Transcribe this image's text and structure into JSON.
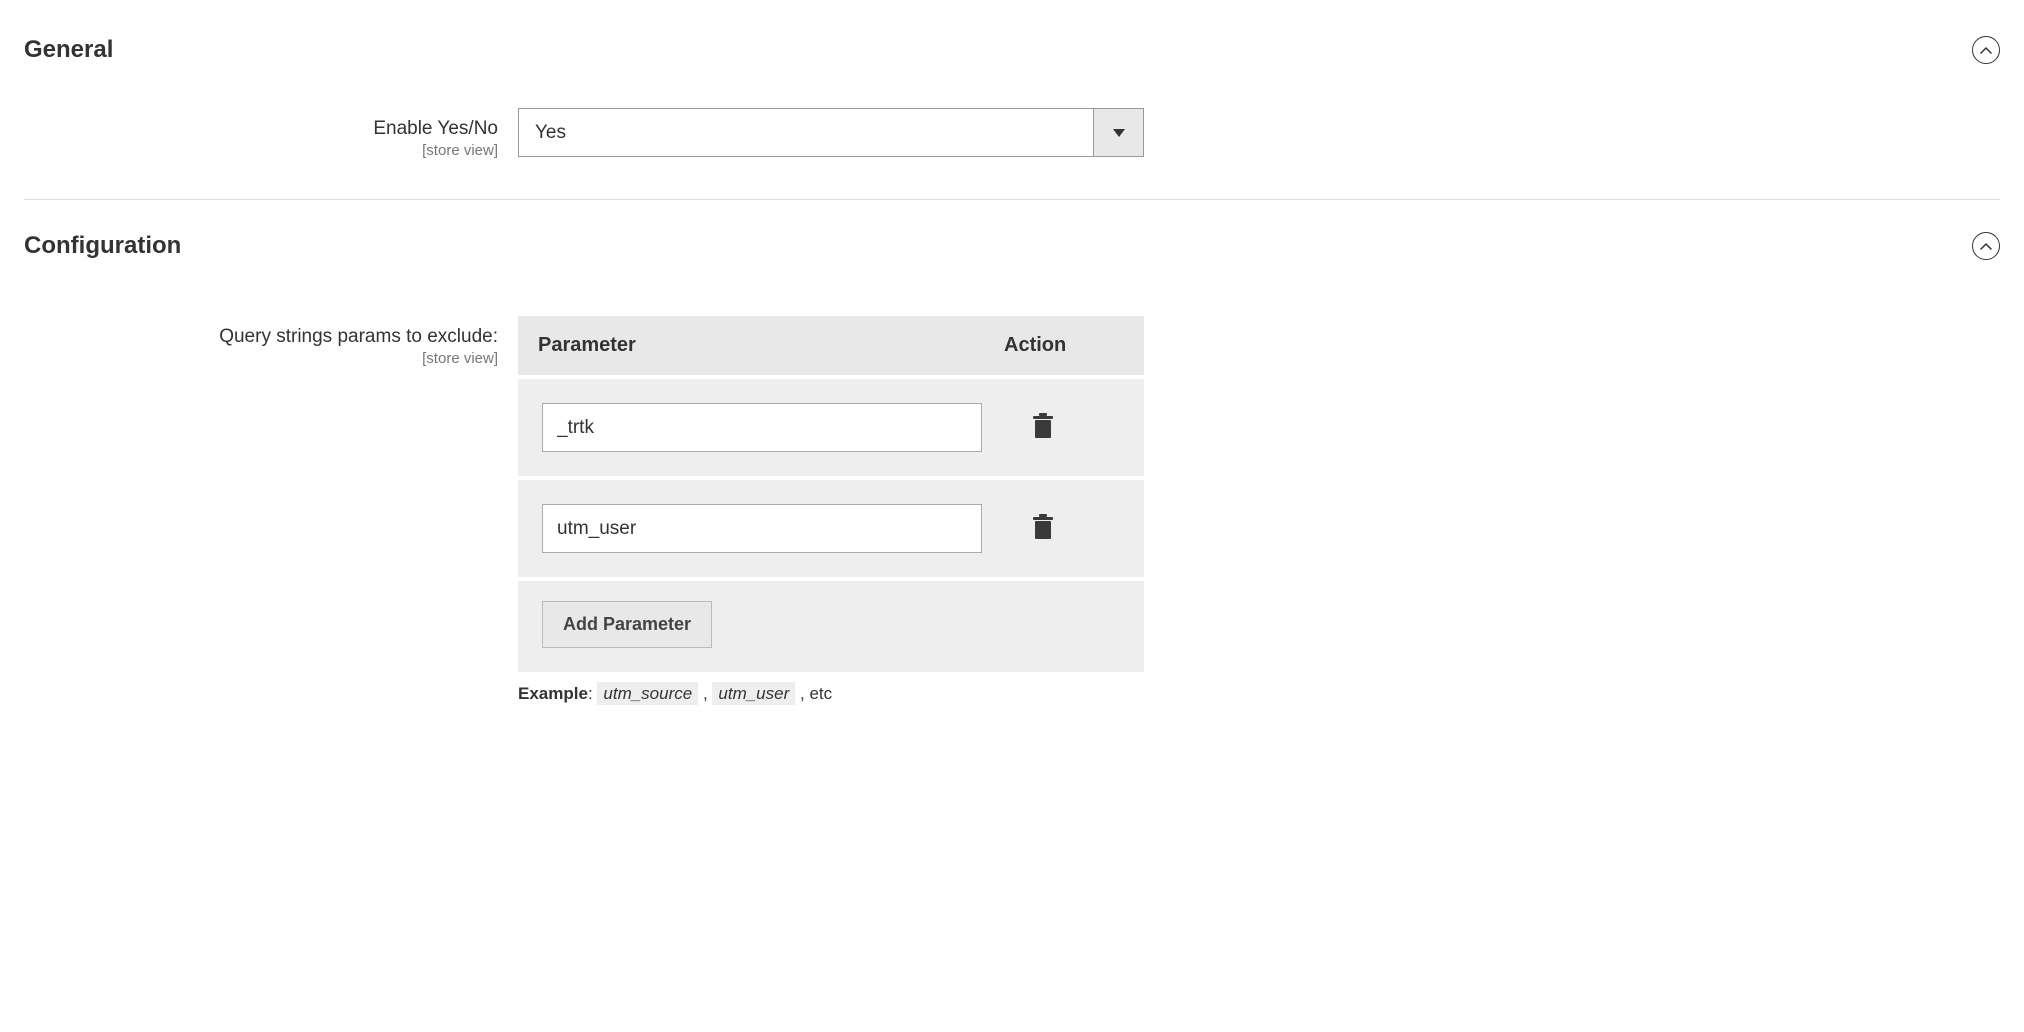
{
  "sections": {
    "general": {
      "title": "General",
      "fields": {
        "enable": {
          "label": "Enable Yes/No",
          "scope": "[store view]",
          "value": "Yes"
        }
      }
    },
    "configuration": {
      "title": "Configuration",
      "fields": {
        "query_params": {
          "label": "Query strings params to exclude:",
          "scope": "[store view]",
          "columns": {
            "parameter": "Parameter",
            "action": "Action"
          },
          "rows": [
            {
              "value": "_trtk"
            },
            {
              "value": "utm_user"
            }
          ],
          "add_button": "Add Parameter",
          "example": {
            "label": "Example",
            "items": [
              "utm_source",
              "utm_user"
            ],
            "suffix": ", etc"
          }
        }
      }
    }
  }
}
